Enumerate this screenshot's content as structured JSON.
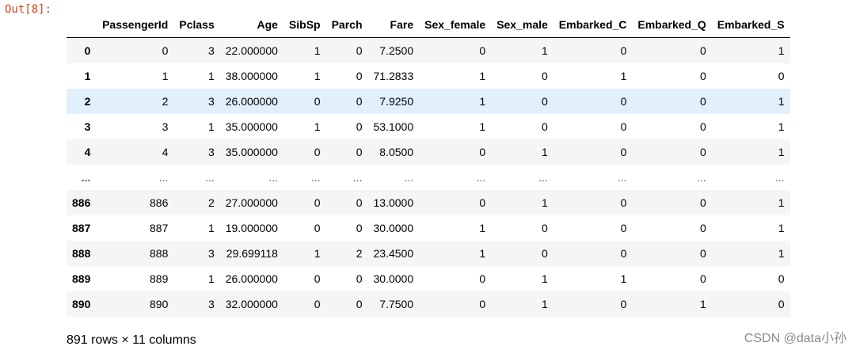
{
  "prompt": "Out[8]:",
  "table": {
    "columns": [
      "",
      "PassengerId",
      "Pclass",
      "Age",
      "SibSp",
      "Parch",
      "Fare",
      "Sex_female",
      "Sex_male",
      "Embarked_C",
      "Embarked_Q",
      "Embarked_S"
    ],
    "rows": [
      {
        "index": "0",
        "cells": [
          "0",
          "3",
          "22.000000",
          "1",
          "0",
          "7.2500",
          "0",
          "1",
          "0",
          "0",
          "1"
        ]
      },
      {
        "index": "1",
        "cells": [
          "1",
          "1",
          "38.000000",
          "1",
          "0",
          "71.2833",
          "1",
          "0",
          "1",
          "0",
          "0"
        ]
      },
      {
        "index": "2",
        "cells": [
          "2",
          "3",
          "26.000000",
          "0",
          "0",
          "7.9250",
          "1",
          "0",
          "0",
          "0",
          "1"
        ],
        "hover": true
      },
      {
        "index": "3",
        "cells": [
          "3",
          "1",
          "35.000000",
          "1",
          "0",
          "53.1000",
          "1",
          "0",
          "0",
          "0",
          "1"
        ]
      },
      {
        "index": "4",
        "cells": [
          "4",
          "3",
          "35.000000",
          "0",
          "0",
          "8.0500",
          "0",
          "1",
          "0",
          "0",
          "1"
        ]
      },
      {
        "index": "...",
        "cells": [
          "...",
          "...",
          "...",
          "...",
          "...",
          "...",
          "...",
          "...",
          "...",
          "...",
          "..."
        ],
        "ellipsis": true
      },
      {
        "index": "886",
        "cells": [
          "886",
          "2",
          "27.000000",
          "0",
          "0",
          "13.0000",
          "0",
          "1",
          "0",
          "0",
          "1"
        ]
      },
      {
        "index": "887",
        "cells": [
          "887",
          "1",
          "19.000000",
          "0",
          "0",
          "30.0000",
          "1",
          "0",
          "0",
          "0",
          "1"
        ]
      },
      {
        "index": "888",
        "cells": [
          "888",
          "3",
          "29.699118",
          "1",
          "2",
          "23.4500",
          "1",
          "0",
          "0",
          "0",
          "1"
        ]
      },
      {
        "index": "889",
        "cells": [
          "889",
          "1",
          "26.000000",
          "0",
          "0",
          "30.0000",
          "0",
          "1",
          "1",
          "0",
          "0"
        ]
      },
      {
        "index": "890",
        "cells": [
          "890",
          "3",
          "32.000000",
          "0",
          "0",
          "7.7500",
          "0",
          "1",
          "0",
          "1",
          "0"
        ]
      }
    ]
  },
  "shape_text": "891 rows × 11 columns",
  "watermark": "CSDN @data小孙",
  "colors": {
    "prompt": "#d84315",
    "row_stripe": "#f5f5f5",
    "row_hover": "#e1f0fb"
  }
}
